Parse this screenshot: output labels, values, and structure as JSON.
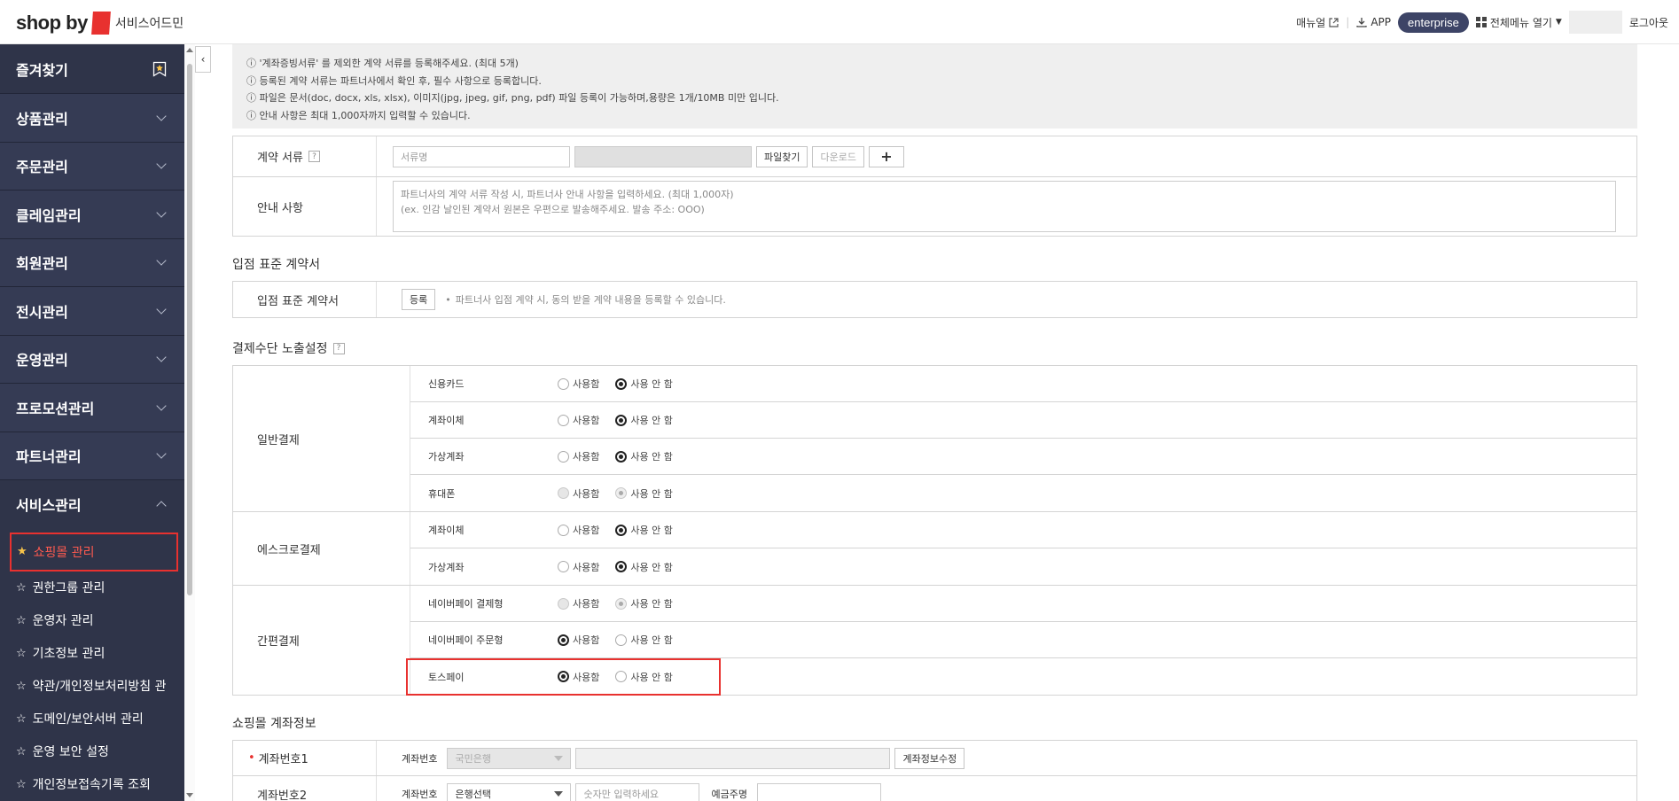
{
  "header": {
    "logo_text": "shop by",
    "logo_sub": "서비스어드민",
    "manual": "매뉴얼",
    "app": "APP",
    "plan": "enterprise",
    "all_menu": "전체메뉴 열기",
    "logout": "로그아웃"
  },
  "sidebar": {
    "favorites": "즐겨찾기",
    "items": [
      {
        "label": "상품관리"
      },
      {
        "label": "주문관리"
      },
      {
        "label": "클레임관리"
      },
      {
        "label": "회원관리"
      },
      {
        "label": "전시관리"
      },
      {
        "label": "운영관리"
      },
      {
        "label": "프로모션관리"
      },
      {
        "label": "파트너관리"
      },
      {
        "label": "서비스관리"
      }
    ],
    "sub_items": [
      {
        "label": "쇼핑몰 관리"
      },
      {
        "label": "권한그룹 관리"
      },
      {
        "label": "운영자 관리"
      },
      {
        "label": "기초정보 관리"
      },
      {
        "label": "약관/개인정보처리방침 관"
      },
      {
        "label": "도메인/보안서버 관리"
      },
      {
        "label": "운영 보안 설정"
      },
      {
        "label": "개인정보접속기록 조회"
      }
    ]
  },
  "notice": [
    "ⓘ '계좌증빙서류' 를 제외한 계약 서류를 등록해주세요. (최대 5개)",
    "ⓘ 등록된 계약 서류는 파트너사에서 확인 후, 필수 사항으로 등록합니다.",
    "ⓘ 파일은 문서(doc, docx, xls, xlsx), 이미지(jpg, jpeg, gif, png, pdf) 파일 등록이 가능하며,용량은 1개/10MB 미만 입니다.",
    "ⓘ 안내 사항은 최대 1,000자까지 입력할 수 있습니다."
  ],
  "contract": {
    "doc_label": "계약 서류",
    "doc_placeholder": "서류명",
    "find_file": "파일찾기",
    "download": "다운로드",
    "plus": "+",
    "guide_label": "안내 사항",
    "guide_placeholder_1": "파트너사의 계약 서류 작성 시, 파트너사 안내 사항을 입력하세요. (최대 1,000자)",
    "guide_placeholder_2": "(ex. 인감 날인된 계약서 원본은 우편으로 발송해주세요. 발송 주소: OOO)"
  },
  "standard": {
    "title": "입점 표준 계약서",
    "label": "입점 표준 계약서",
    "register": "등록",
    "desc": "파트너사 입점 계약 시, 동의 받을 계약 내용을 등록할 수 있습니다."
  },
  "payment": {
    "title": "결제수단 노출설정",
    "use": "사용함",
    "nouse": "사용 안 함",
    "groups": [
      {
        "label": "일반결제",
        "rows": [
          {
            "name": "신용카드",
            "state": "off"
          },
          {
            "name": "계좌이체",
            "state": "off"
          },
          {
            "name": "가상계좌",
            "state": "off"
          },
          {
            "name": "휴대폰",
            "state": "disabled"
          }
        ]
      },
      {
        "label": "에스크로결제",
        "rows": [
          {
            "name": "계좌이체",
            "state": "off"
          },
          {
            "name": "가상계좌",
            "state": "off"
          }
        ]
      },
      {
        "label": "간편결제",
        "rows": [
          {
            "name": "네이버페이 결제형",
            "state": "disabled"
          },
          {
            "name": "네이버페이 주문형",
            "state": "on"
          },
          {
            "name": "토스페이",
            "state": "on"
          }
        ]
      }
    ]
  },
  "account": {
    "title": "쇼핑몰 계좌정보",
    "row1_label": "계좌번호1",
    "row2_label": "계좌번호2",
    "acct_no": "계좌번호",
    "bank1": "국민은행",
    "edit": "계좌정보수정",
    "bank_select": "은행선택",
    "number_placeholder": "숫자만 입력하세요",
    "holder": "예금주명"
  }
}
